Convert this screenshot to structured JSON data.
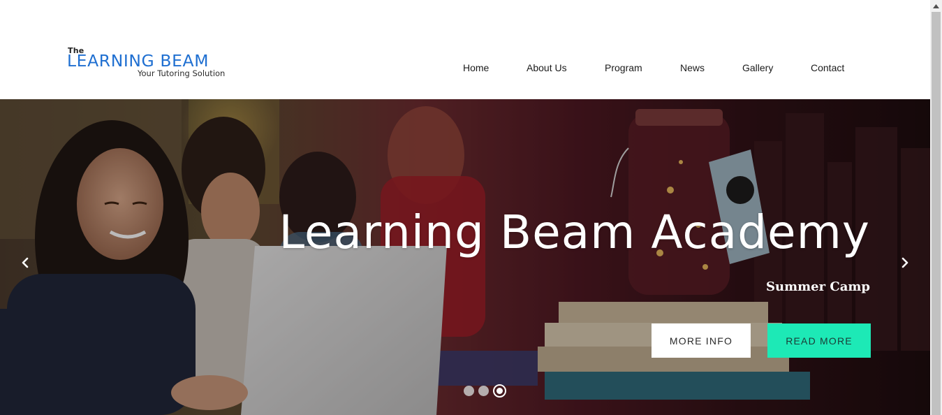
{
  "header": {
    "logo": {
      "the": "The",
      "name": "LEARNING BEAM",
      "tagline": "Your Tutoring Solution"
    },
    "nav": [
      {
        "label": "Home"
      },
      {
        "label": "About Us"
      },
      {
        "label": "Program"
      },
      {
        "label": "News"
      },
      {
        "label": "Gallery"
      },
      {
        "label": "Contact"
      }
    ]
  },
  "hero": {
    "title": "Learning Beam Academy",
    "subtitle": "Summer Camp",
    "more_info_label": "MORE INFO",
    "read_more_label": "READ MORE",
    "slide_count": 3,
    "active_slide": 3
  },
  "icons": {
    "prev": "chevron-left-icon",
    "next": "chevron-right-icon",
    "scroll_up": "triangle-up-icon"
  },
  "colors": {
    "logo_blue": "#1f6fd1",
    "accent_button": "#1de9b6",
    "nav_text": "#1b1b1b"
  }
}
